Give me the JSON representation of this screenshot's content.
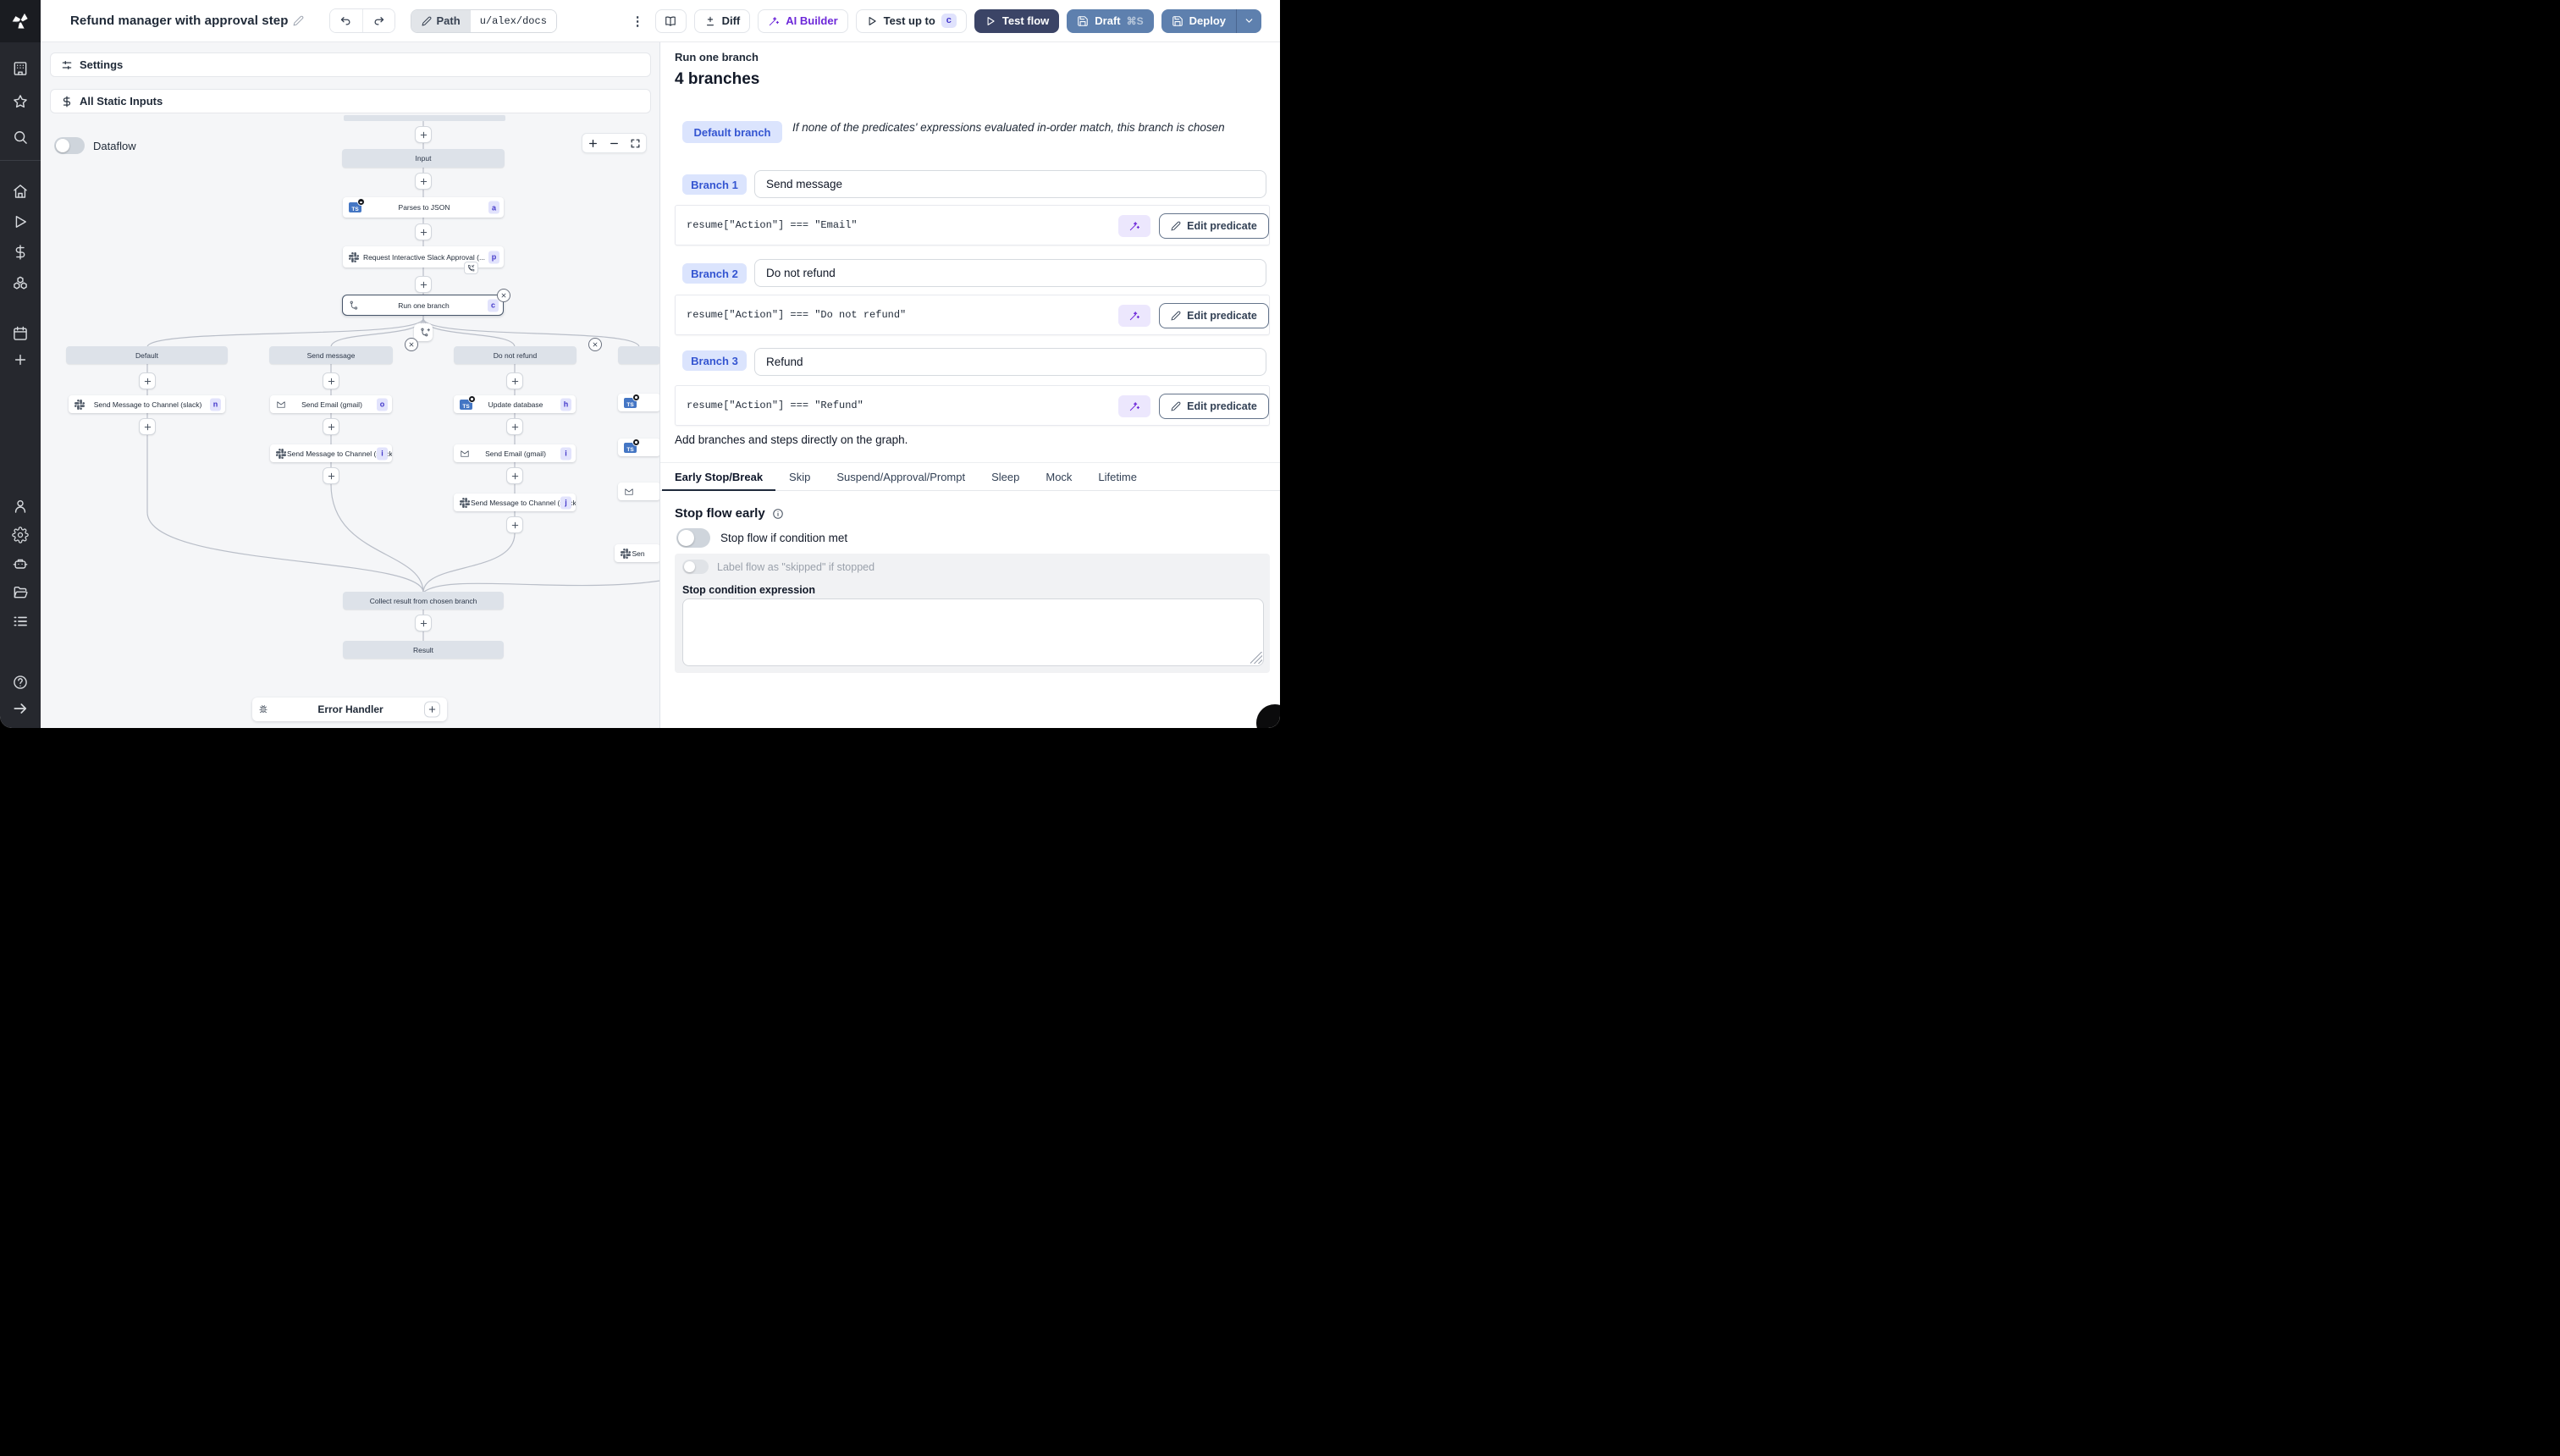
{
  "topbar": {
    "title": "Refund manager with approval step",
    "path_label": "Path",
    "path_value": "u/alex/docs",
    "diff_label": "Diff",
    "ai_builder_label": "AI Builder",
    "test_up_to_label": "Test up to",
    "test_up_to_badge": "c",
    "test_flow_label": "Test flow",
    "draft_label": "Draft",
    "draft_shortcut": "⌘S",
    "deploy_label": "Deploy"
  },
  "rail": {
    "icons": [
      "workspace",
      "favorites",
      "search",
      "home",
      "runs",
      "variables",
      "resources",
      "schedules",
      "add",
      "users",
      "settings",
      "workers",
      "folders",
      "logs",
      "help",
      "collapse"
    ]
  },
  "flow": {
    "settings_label": "Settings",
    "static_inputs_label": "All Static Inputs",
    "dataflow_label": "Dataflow",
    "graph": {
      "nodes": [
        {
          "id": "input",
          "label": "Input",
          "type": "gray"
        },
        {
          "id": "parses",
          "label": "Parses to JSON",
          "badge": "a",
          "icon": "ts",
          "type": "step"
        },
        {
          "id": "slack_approval",
          "label": "Request Interactive Slack Approval (...",
          "badge": "p",
          "icon": "slack",
          "type": "step",
          "overlay": "phone-incoming"
        },
        {
          "id": "run_one_branch",
          "label": "Run one branch",
          "badge": "c",
          "icon": "branch-split",
          "type": "sel",
          "close": true
        },
        {
          "id": "branch_add",
          "label": "",
          "icon": "branch-add",
          "type": "mini"
        },
        {
          "id": "h_default",
          "label": "Default",
          "type": "gray"
        },
        {
          "id": "h_send",
          "label": "Send message",
          "type": "gray",
          "close": true
        },
        {
          "id": "h_refundno",
          "label": "Do not refund",
          "type": "gray",
          "close": true
        },
        {
          "id": "h_partial",
          "label": "",
          "type": "gray"
        },
        {
          "id": "c1s1",
          "label": "Send Message to Channel (slack)",
          "badge": "n",
          "icon": "slack",
          "type": "step"
        },
        {
          "id": "c2s1",
          "label": "Send Email (gmail)",
          "badge": "o",
          "icon": "gmail",
          "type": "step"
        },
        {
          "id": "c3s1",
          "label": "Update database",
          "badge": "h",
          "icon": "ts",
          "type": "step"
        },
        {
          "id": "c4s1",
          "label": "",
          "icon": "ts",
          "type": "step"
        },
        {
          "id": "c2s2",
          "label": "Send Message to Channel (slack)",
          "badge": "i",
          "icon": "slack",
          "type": "step"
        },
        {
          "id": "c3s2",
          "label": "Send Email (gmail)",
          "badge": "i",
          "icon": "gmail",
          "type": "step"
        },
        {
          "id": "c4s2",
          "label": "",
          "icon": "ts",
          "type": "step"
        },
        {
          "id": "c3s3",
          "label": "Send Message to Channel (slack)",
          "badge": "j",
          "icon": "slack",
          "type": "step"
        },
        {
          "id": "c4s3",
          "label": "",
          "icon": "gmail",
          "type": "step"
        },
        {
          "id": "c4s4",
          "label": "Sen",
          "icon": "slack",
          "type": "step"
        },
        {
          "id": "collect",
          "label": "Collect result from chosen branch",
          "type": "gray"
        },
        {
          "id": "result",
          "label": "Result",
          "type": "gray"
        },
        {
          "id": "error_handler",
          "label": "Error Handler",
          "icon": "bug",
          "type": "errn",
          "plus": true
        }
      ]
    }
  },
  "panel": {
    "subtitle": "Run one branch",
    "title": "4 branches",
    "default_branch": {
      "chip": "Default branch",
      "description": "If none of the predicates' expressions evaluated in-order match, this branch is chosen"
    },
    "branches": [
      {
        "chip": "Branch 1",
        "summary": "Send message",
        "predicate": "resume[\"Action\"] === \"Email\""
      },
      {
        "chip": "Branch 2",
        "summary": "Do not refund",
        "predicate": "resume[\"Action\"] === \"Do not refund\""
      },
      {
        "chip": "Branch 3",
        "summary": "Refund",
        "predicate": "resume[\"Action\"] === \"Refund\""
      }
    ],
    "edit_predicate_label": "Edit predicate",
    "add_note": "Add branches and steps directly on the graph.",
    "tabs": [
      "Early Stop/Break",
      "Skip",
      "Suspend/Approval/Prompt",
      "Sleep",
      "Mock",
      "Lifetime"
    ],
    "active_tab": "Early Stop/Break",
    "early_stop": {
      "heading": "Stop flow early",
      "toggle_label": "Stop flow if condition met",
      "skip_toggle_label": "Label flow as \"skipped\" if stopped",
      "expression_label": "Stop condition expression",
      "expression_value": ""
    }
  }
}
